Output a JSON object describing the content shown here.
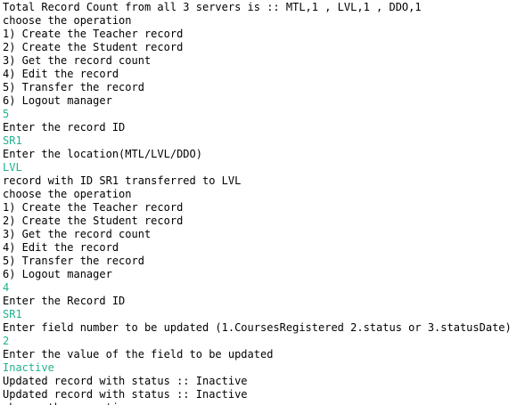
{
  "console": {
    "colors": {
      "background": "#ffffff",
      "output_text": "#000000",
      "user_input_text": "#1fb28f"
    },
    "lines": [
      {
        "text": "Total Record Count from all 3 servers is :: MTL,1 , LVL,1 , DDO,1",
        "kind": "output"
      },
      {
        "text": "choose the operation",
        "kind": "output"
      },
      {
        "text": "1) Create the Teacher record",
        "kind": "output"
      },
      {
        "text": "2) Create the Student record",
        "kind": "output"
      },
      {
        "text": "3) Get the record count",
        "kind": "output"
      },
      {
        "text": "4) Edit the record",
        "kind": "output"
      },
      {
        "text": "5) Transfer the record",
        "kind": "output"
      },
      {
        "text": "6) Logout manager",
        "kind": "output"
      },
      {
        "text": "5",
        "kind": "input"
      },
      {
        "text": "Enter the record ID",
        "kind": "output"
      },
      {
        "text": "SR1",
        "kind": "input"
      },
      {
        "text": "Enter the location(MTL/LVL/DDO)",
        "kind": "output"
      },
      {
        "text": "LVL",
        "kind": "input"
      },
      {
        "text": "record with ID SR1 transferred to LVL",
        "kind": "output"
      },
      {
        "text": "choose the operation",
        "kind": "output"
      },
      {
        "text": "1) Create the Teacher record",
        "kind": "output"
      },
      {
        "text": "2) Create the Student record",
        "kind": "output"
      },
      {
        "text": "3) Get the record count",
        "kind": "output"
      },
      {
        "text": "4) Edit the record",
        "kind": "output"
      },
      {
        "text": "5) Transfer the record",
        "kind": "output"
      },
      {
        "text": "6) Logout manager",
        "kind": "output"
      },
      {
        "text": "4",
        "kind": "input"
      },
      {
        "text": "Enter the Record ID",
        "kind": "output"
      },
      {
        "text": "SR1",
        "kind": "input"
      },
      {
        "text": "Enter field number to be updated (1.CoursesRegistered 2.status or 3.statusDate)",
        "kind": "output"
      },
      {
        "text": "2",
        "kind": "input"
      },
      {
        "text": "Enter the value of the field to be updated",
        "kind": "output"
      },
      {
        "text": "Inactive",
        "kind": "input"
      },
      {
        "text": "Updated record with status :: Inactive",
        "kind": "output"
      },
      {
        "text": "Updated record with status :: Inactive",
        "kind": "output"
      },
      {
        "text": "choose the operation",
        "kind": "output"
      }
    ]
  }
}
